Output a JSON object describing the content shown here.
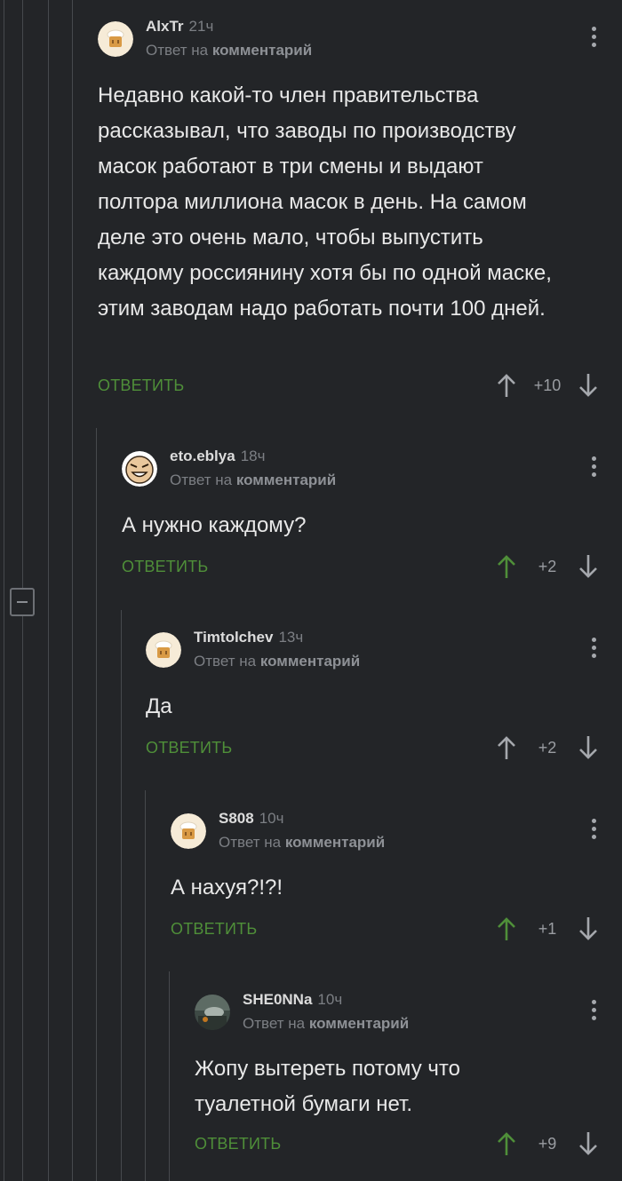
{
  "ui": {
    "reply_prefix": "Ответ на",
    "reply_link": "комментарий",
    "reply_button": "ОТВЕТИТЬ"
  },
  "colors": {
    "background": "#232528",
    "reply_green": "#4f8f39",
    "upvote_active": "#4f8f39",
    "arrow_neutral": "#a5a8ad"
  },
  "comments": [
    {
      "author": "AlxTr",
      "time": "21ч",
      "avatar": "cook-avatar-icon",
      "text": "Недавно какой-то член правительства рассказывал, что заводы по производству масок работают в три смены и выдают полтора миллиона масок в день. На самом деле это очень мало, чтобы выпустить каждому россиянину хотя бы по одной маске, этим заводам надо работать почти 100 дней.",
      "score": "+10",
      "upvoted": false
    },
    {
      "author": "eto.eblya",
      "time": "18ч",
      "avatar": "smiling-face-avatar-icon",
      "text": "А нужно каждому?",
      "score": "+2",
      "upvoted": true
    },
    {
      "author": "Timtolchev",
      "time": "13ч",
      "avatar": "cook-avatar-icon",
      "text": "Да",
      "score": "+2",
      "upvoted": false
    },
    {
      "author": "S808",
      "time": "10ч",
      "avatar": "cook-avatar-icon",
      "text": "А нахуя?!?!",
      "score": "+1",
      "upvoted": true
    },
    {
      "author": "SHE0NNa",
      "time": "10ч",
      "avatar": "photo-avatar-icon",
      "text": "Жопу вытереть потому что туалетной бумаги нет.",
      "score": "+9",
      "upvoted": true
    }
  ]
}
